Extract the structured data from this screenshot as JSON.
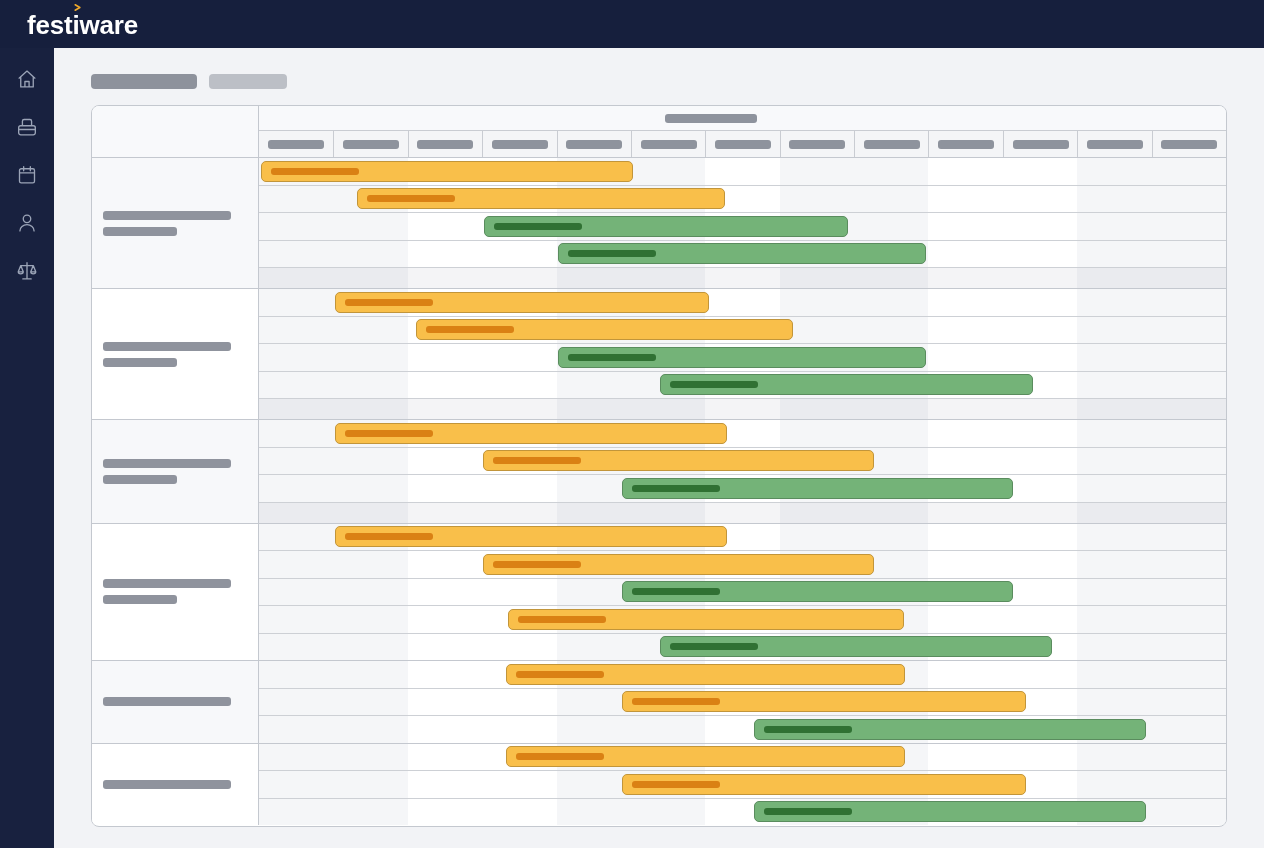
{
  "top_bar": {
    "logo": "festiware"
  },
  "sidebar": {
    "items": [
      {
        "kind": "home"
      },
      {
        "kind": "archive"
      },
      {
        "kind": "calendar"
      },
      {
        "kind": "person"
      },
      {
        "kind": "scale"
      }
    ]
  },
  "gantt": {
    "groups": [
      {
        "kind": "two-line",
        "rows": [
          {
            "kind": "task",
            "color": "#f9bf4a"
          },
          {
            "kind": "task",
            "color": "#f9bf4a"
          },
          {
            "kind": "task",
            "color": "#74b378"
          },
          {
            "kind": "task",
            "color": "#74b378"
          },
          {
            "kind": "spacer"
          }
        ]
      },
      {
        "kind": "two-line",
        "rows": [
          {
            "kind": "task",
            "color": "#f9bf4a"
          },
          {
            "kind": "task",
            "color": "#f9bf4a"
          },
          {
            "kind": "task",
            "color": "#74b378"
          },
          {
            "kind": "task",
            "color": "#74b378"
          },
          {
            "kind": "spacer"
          }
        ]
      },
      {
        "kind": "two-line",
        "rows": [
          {
            "kind": "task",
            "color": "#f9bf4a"
          },
          {
            "kind": "task",
            "color": "#f9bf4a"
          },
          {
            "kind": "task",
            "color": "#74b378"
          },
          {
            "kind": "spacer"
          }
        ]
      },
      {
        "kind": "two-line",
        "rows": [
          {
            "kind": "task",
            "color": "#f9bf4a"
          },
          {
            "kind": "task",
            "color": "#f9bf4a"
          },
          {
            "kind": "task",
            "color": "#74b378"
          },
          {
            "kind": "task",
            "color": "#f9bf4a"
          },
          {
            "kind": "task",
            "color": "#74b378"
          }
        ]
      },
      {
        "kind": "one-line",
        "rows": [
          {
            "kind": "task",
            "color": "#f9bf4a"
          },
          {
            "kind": "task",
            "color": "#f9bf4a"
          },
          {
            "kind": "task",
            "color": "#74b378"
          }
        ]
      },
      {
        "kind": "one-line",
        "rows": [
          {
            "kind": "task",
            "color": "#f9bf4a"
          },
          {
            "kind": "task",
            "color": "#f9bf4a"
          },
          {
            "kind": "task",
            "color": "#74b378"
          }
        ]
      }
    ]
  }
}
